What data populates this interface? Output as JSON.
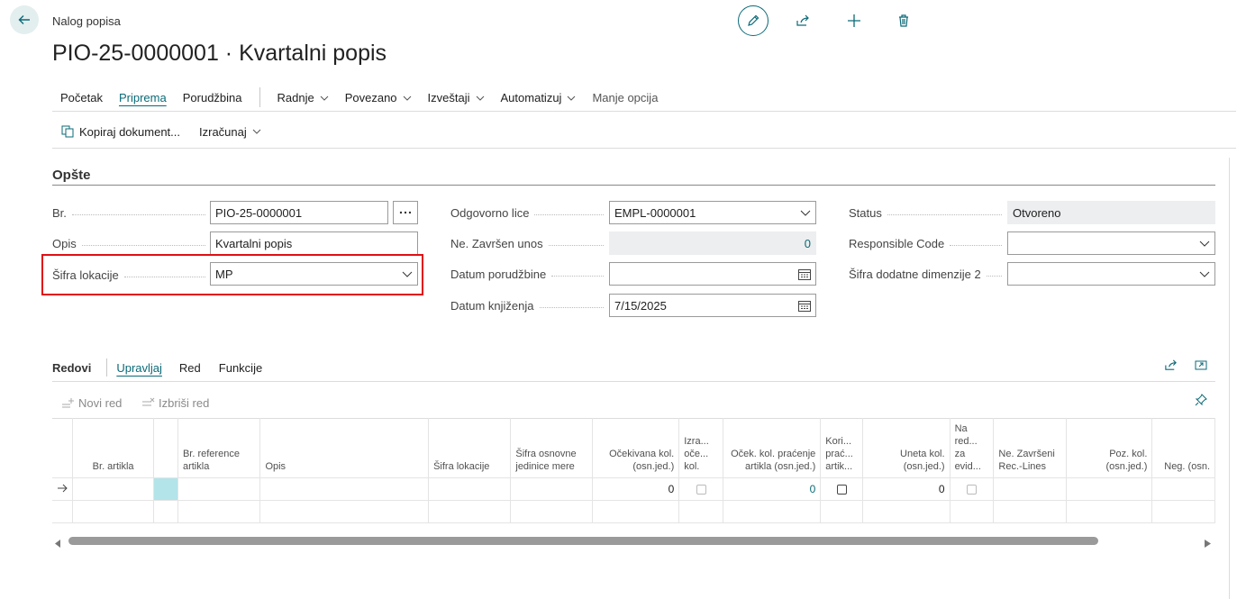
{
  "header": {
    "breadcrumb": "Nalog popisa",
    "title": "PIO-25-0000001 · Kvartalni popis"
  },
  "menu": {
    "items": [
      "Početak",
      "Priprema",
      "Porudžbina"
    ],
    "dropdowns": [
      "Radnje",
      "Povezano",
      "Izveštaji",
      "Automatizuj"
    ],
    "less": "Manje opcija"
  },
  "subbar": {
    "copy": "Kopiraj dokument...",
    "calc": "Izračunaj"
  },
  "general": {
    "section": "Opšte",
    "no_label": "Br.",
    "no_value": "PIO-25-0000001",
    "desc_label": "Opis",
    "desc_value": "Kvartalni popis",
    "loc_label": "Šifra lokacije",
    "loc_value": "MP",
    "resp_label": "Odgovorno lice",
    "resp_value": "EMPL-0000001",
    "unfin_label": "Ne. Završen unos",
    "unfin_value": "0",
    "order_date_label": "Datum porudžbine",
    "order_date_value": "",
    "post_date_label": "Datum knjiženja",
    "post_date_value": "7/15/2025",
    "status_label": "Status",
    "status_value": "Otvoreno",
    "rc_label": "Responsible Code",
    "rc_value": "",
    "dim_label": "Šifra dodatne dimenzije 2",
    "dim_value": ""
  },
  "lines": {
    "title": "Redovi",
    "tabs": [
      "Upravljaj",
      "Red",
      "Funkcije"
    ],
    "new_row": "Novi red",
    "delete_row": "Izbriši red",
    "columns": [
      "Br. artikla",
      "",
      "Br. reference artikla",
      "Opis",
      "Šifra lokacije",
      "Šifra osnovne jedinice mere",
      "Očekivana kol. (osn.jed.)",
      "Izra... oče... kol.",
      "Oček. kol. praćenje artikla (osn.jed.)",
      "Kori... prać... artik...",
      "Uneta kol. (osn.jed.)",
      "Na red... za evid...",
      "Ne. Završeni Rec.-Lines",
      "Poz. kol. (osn.jed.)",
      "Neg. (osn."
    ],
    "row": {
      "expected": "0",
      "tracking": "0",
      "entered": "0"
    }
  },
  "colors": {
    "accent": "#0b6a77",
    "highlight": "#e00f14"
  }
}
